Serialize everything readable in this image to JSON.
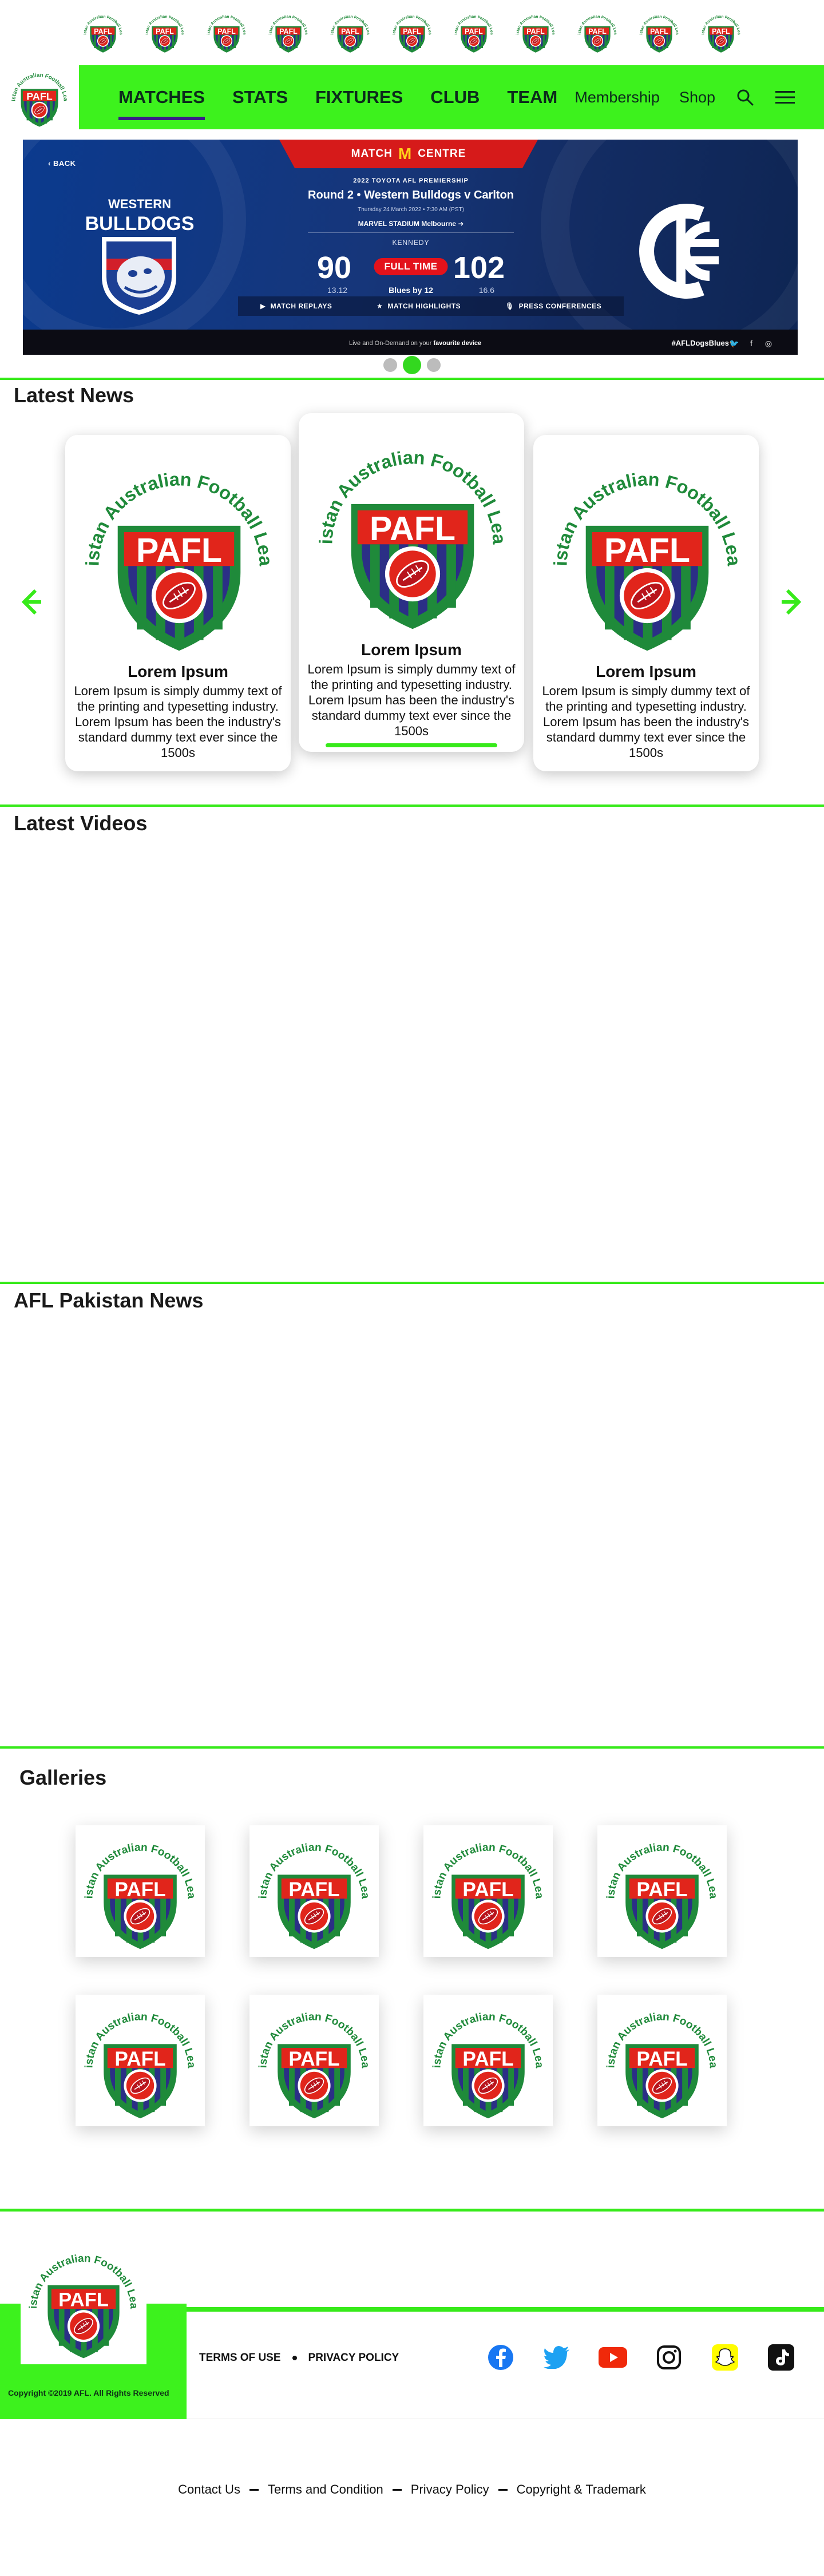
{
  "logo": {
    "arc_text": "Pakistan Australian Football League",
    "shield_text": "PAFL"
  },
  "club_strip": {
    "count": 11
  },
  "nav": {
    "links": [
      "MATCHES",
      "STATS",
      "FIXTURES",
      "CLUB",
      "TEAM"
    ],
    "active": "MATCHES",
    "membership": "Membership",
    "shop": "Shop"
  },
  "hero": {
    "back": "‹ BACK",
    "banner_left": "MATCH",
    "banner_right": "CENTRE",
    "competition": "2022 TOYOTA AFL PREMIERSHIP",
    "round": "Round 2 • Western Bulldogs v Carlton",
    "date": "Thursday 24 March 2022 • 7:30 AM (PST)",
    "venue": "MARVEL STADIUM Melbourne",
    "leader": "KENNEDY",
    "home_team_line1": "WESTERN",
    "home_team_line2": "BULLDOGS",
    "home_score": "90",
    "home_detail": "13.12",
    "away_score": "102",
    "away_detail": "16.6",
    "status": "FULL TIME",
    "margin": "Blues by 12",
    "actions": [
      "MATCH REPLAYS",
      "MATCH HIGHLIGHTS",
      "PRESS CONFERENCES"
    ],
    "live_text_pre": "Live and On-Demand on your ",
    "live_text_bold": "favourite device",
    "hashtag": "#AFLDogsBlues"
  },
  "sections": {
    "latest_news": "Latest News",
    "latest_videos": "Latest Videos",
    "afl_pakistan_news": "AFL Pakistan News",
    "galleries": "Galleries"
  },
  "news_cards": [
    {
      "title": "Lorem Ipsum",
      "text": "Lorem Ipsum is simply dummy text of the printing and typesetting industry. Lorem Ipsum has been the industry's standard dummy text ever since the 1500s"
    },
    {
      "title": "Lorem Ipsum",
      "text": "Lorem Ipsum is simply dummy text of the printing and typesetting industry. Lorem Ipsum has been the industry's standard dummy text ever since the 1500s"
    },
    {
      "title": "Lorem Ipsum",
      "text": "Lorem Ipsum is simply dummy text of the printing and typesetting industry. Lorem Ipsum has been the industry's standard dummy text ever since the 1500s"
    }
  ],
  "footer": {
    "copyright": "Copyright ©2019 AFL. All Rights Reserved",
    "terms": "TERMS OF USE",
    "privacy": "PRIVACY POLICY",
    "socials": [
      "facebook-icon",
      "twitter-icon",
      "youtube-icon",
      "instagram-icon",
      "snapchat-icon",
      "tiktok-icon"
    ],
    "bottom_links": [
      "Contact Us",
      "Terms  and Condition",
      "Privacy Policy",
      "Copyright  & Trademark"
    ]
  },
  "colors": {
    "brand_green": "#3df21d",
    "accent_purple": "#3a1e87",
    "shield_red": "#e1251b",
    "shield_green": "#1f8a3a"
  }
}
